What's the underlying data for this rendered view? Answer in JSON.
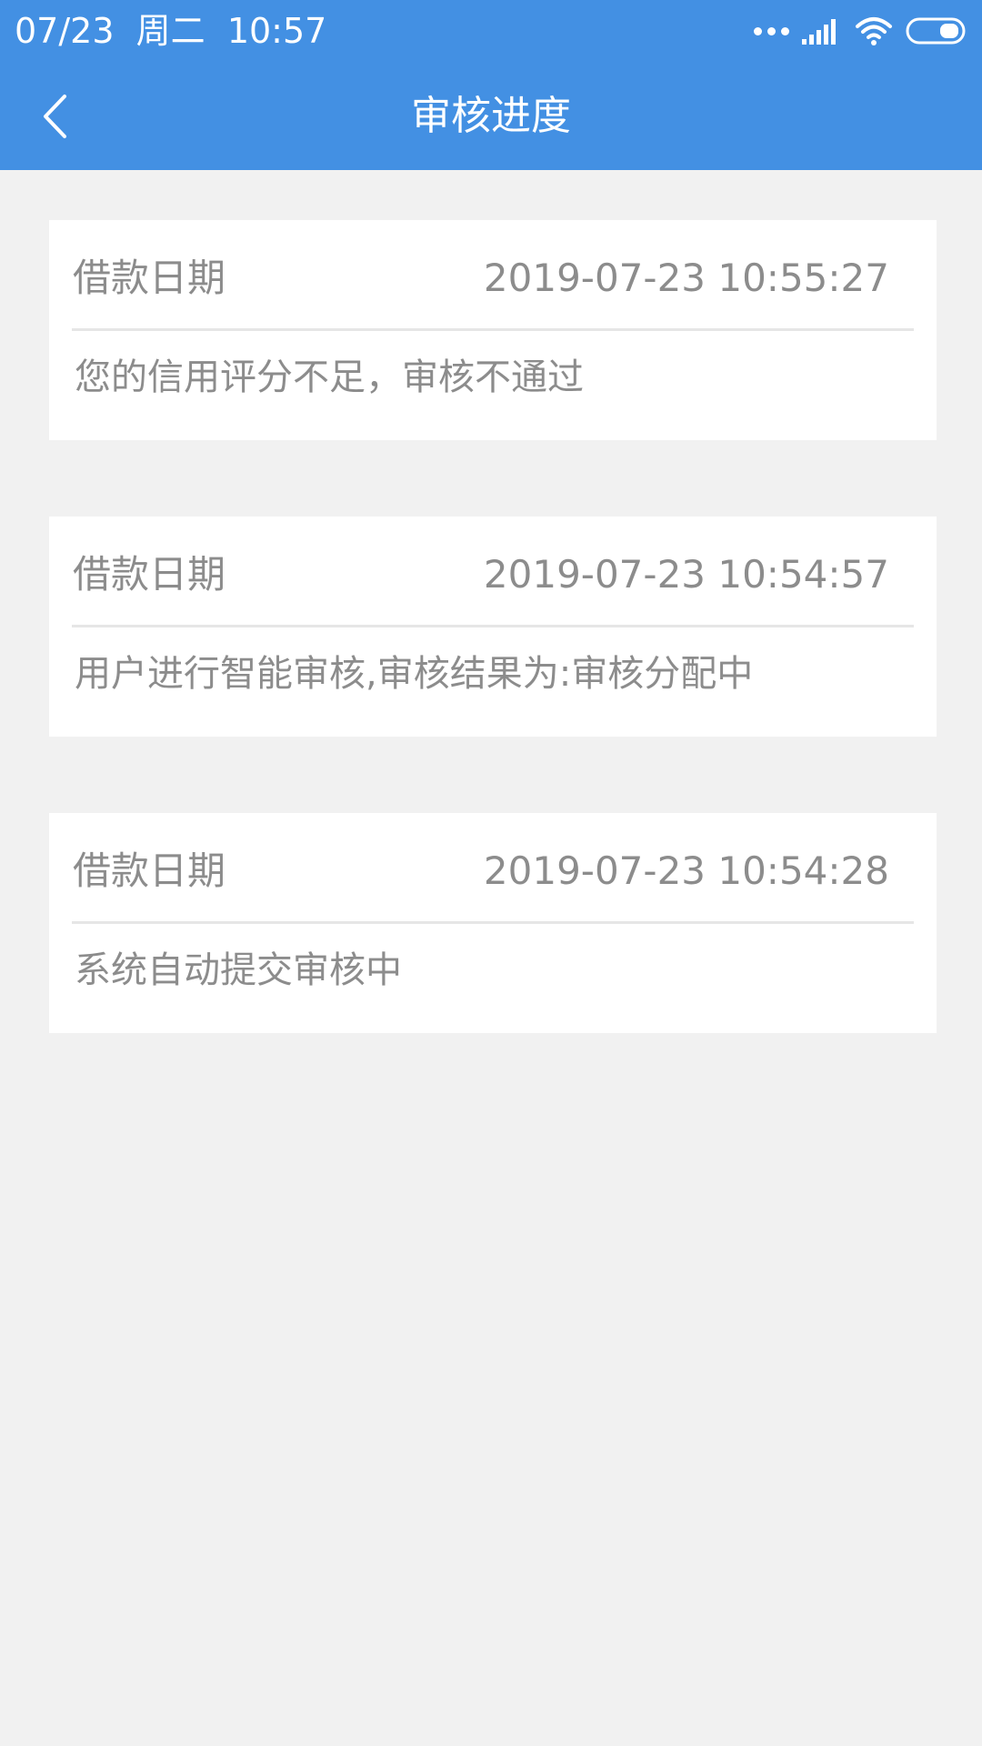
{
  "status_bar": {
    "time": "07/23  周二  10:57"
  },
  "nav": {
    "title": "审核进度"
  },
  "records": [
    {
      "label": "借款日期",
      "datetime": "2019-07-23 10:55:27",
      "message": "您的信用评分不足，审核不通过"
    },
    {
      "label": "借款日期",
      "datetime": "2019-07-23 10:54:57",
      "message": "用户进行智能审核,审核结果为:审核分配中"
    },
    {
      "label": "借款日期",
      "datetime": "2019-07-23 10:54:28",
      "message": "系统自动提交审核中"
    }
  ],
  "icons": {
    "back": "chevron-left-icon",
    "signal": "signal-icon",
    "wifi": "wifi-icon",
    "battery": "battery-icon"
  },
  "colors": {
    "header": "#4390e3",
    "background": "#f1f1f1",
    "card": "#ffffff",
    "text_secondary": "#8c8c8c"
  }
}
